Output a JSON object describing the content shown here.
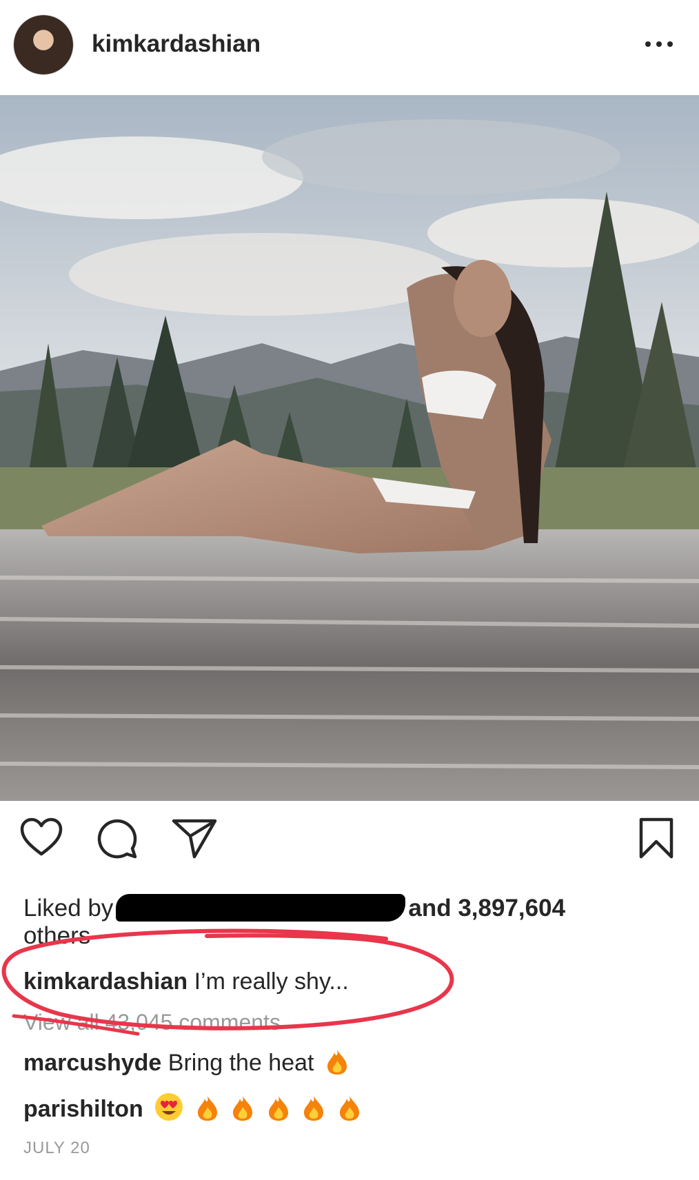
{
  "post": {
    "username": "kimkardashian",
    "likes_prefix": "Liked by",
    "likes_suffix": "and 3,897,604",
    "likes_suffix2": "others",
    "caption_user": "kimkardashian",
    "caption_text": "I’m really shy...",
    "view_comments": "View all 43,045 comments",
    "date": "JULY 20"
  },
  "comments": [
    {
      "user": "marcushyde",
      "text": "Bring the heat",
      "emojis": [
        "fire"
      ]
    },
    {
      "user": "parishilton",
      "text": "",
      "emojis": [
        "heart-eyes",
        "fire",
        "fire",
        "fire",
        "fire",
        "fire"
      ]
    }
  ],
  "icons": {
    "more": "more-dots-icon",
    "like": "heart-icon",
    "comment": "comment-bubble-icon",
    "share": "paper-plane-icon",
    "save": "bookmark-icon"
  },
  "colors": {
    "text": "#262626",
    "muted": "#999999",
    "annotation": "#e8364b"
  }
}
